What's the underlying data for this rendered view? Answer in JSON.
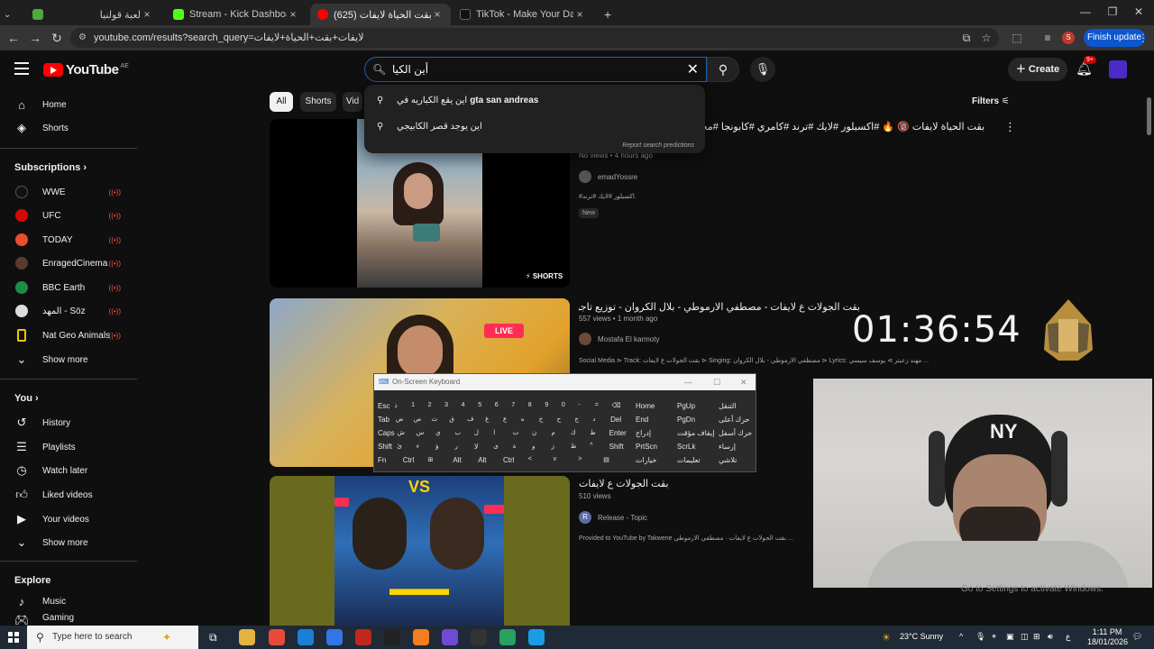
{
  "browser": {
    "tabs": [
      {
        "title": "لعبة قولنيا",
        "color": "#53a83d"
      },
      {
        "title": "Stream - Kick Dashboard",
        "color": "#53fc18"
      },
      {
        "title": "(625) لايفات بقت الحياة لايفات - ",
        "color": "#ff0000"
      },
      {
        "title": "TikTok - Make Your Day",
        "color": "#111111"
      }
    ],
    "new_tab": "+",
    "url": "youtube.com/results?search_query=لايفات+بقت+الحياة+لايفات",
    "profile_initial": "S",
    "finish_update": "Finish update"
  },
  "youtube": {
    "logo": "YouTube",
    "country": "AE",
    "search_value": "أين الكيا",
    "create": "Create",
    "notif_count": "9+",
    "suggestions": [
      {
        "prefix": "اين يقع الكباريه في ",
        "bold": "gta san andreas"
      },
      {
        "prefix": "اين يوجد قصر الكابيجي",
        "bold": ""
      }
    ],
    "report_predictions": "Report search predictions",
    "chips": [
      "All",
      "Shorts",
      "Vid"
    ],
    "filters": "Filters"
  },
  "sidebar": {
    "main": [
      {
        "label": "Home",
        "icon": "home-icon"
      },
      {
        "label": "Shorts",
        "icon": "shorts-icon"
      }
    ],
    "subscriptions_title": "Subscriptions",
    "subscriptions": [
      {
        "label": "WWE",
        "color": "#111111"
      },
      {
        "label": "UFC",
        "color": "#d20a0a"
      },
      {
        "label": "TODAY",
        "color": "#e84f2a"
      },
      {
        "label": "EnragedCinema",
        "color": "#5a3a2a"
      },
      {
        "label": "BBC Earth",
        "color": "#1f8a4c"
      },
      {
        "label": "المهد - Söz",
        "color": "#dddddd"
      },
      {
        "label": "Nat Geo Animals",
        "color": "#f5c400"
      }
    ],
    "show_more_1": "Show more",
    "you_title": "You",
    "you": [
      {
        "label": "History",
        "icon": "history-icon"
      },
      {
        "label": "Playlists",
        "icon": "playlists-icon"
      },
      {
        "label": "Watch later",
        "icon": "watch-later-icon"
      },
      {
        "label": "Liked videos",
        "icon": "liked-videos-icon"
      },
      {
        "label": "Your videos",
        "icon": "your-videos-icon"
      }
    ],
    "show_more_2": "Show more",
    "explore_title": "Explore",
    "explore": [
      {
        "label": "Music",
        "icon": "music-icon"
      },
      {
        "label": "Gaming",
        "icon": "gaming-icon"
      }
    ]
  },
  "results": [
    {
      "title": "بقت الحياة لايفات 🔞 🔥 #اكسبلور #لايك #ترند #كامري #كابونجا #محركات",
      "meta": "No views • 4 hours ago",
      "channel": "emadYossre",
      "desc": "#اكسبلور #لايك #ترند.",
      "badge": "New",
      "overlay": "SHORTS"
    },
    {
      "title": "بقت الجولات ع لايفات - مصطفي الارموطي - بلال الكروان - توزيع تاجو - 2025",
      "meta": "557 views • 1 month ago",
      "channel": "Mostafa El karmoty",
      "desc": "Social Media ⊳ Track: بقت الجولات ع لايفات ⊳ Singing: مصطفي الارموطي - بلال الكروان ⊳ Lyrics: مهند زعيتر ⊳ يوسف سيسي ...",
      "overlay": "LIVE"
    },
    {
      "title": "بقت الجولات ع لايفات",
      "meta": "510 views",
      "channel": "Release - Topic",
      "channel_initial": "R",
      "desc": "Provided to YouTube by Takwene بقت الجولات ع لايفات · مصطفي الارموطي ..."
    }
  ],
  "osk": {
    "title": "On-Screen Keyboard",
    "rows": [
      [
        "Esc",
        "ذ",
        "1",
        "2",
        "3",
        "4",
        "5",
        "6",
        "7",
        "8",
        "9",
        "0",
        "-",
        "=",
        "⌫"
      ],
      [
        "Tab",
        "ض",
        "ص",
        "ث",
        "ق",
        "ف",
        "غ",
        "ع",
        "ه",
        "خ",
        "ح",
        "ج",
        "د",
        "Del"
      ],
      [
        "Caps",
        "ش",
        "س",
        "ي",
        "ب",
        "ل",
        "ا",
        "ت",
        "ن",
        "م",
        "ك",
        "ط",
        "Enter"
      ],
      [
        "Shift",
        "ئ",
        "ء",
        "ؤ",
        "ر",
        "لا",
        "ى",
        "ة",
        "و",
        "ز",
        "ظ",
        "^",
        "Shift"
      ],
      [
        "Fn",
        "Ctrl",
        "⊞",
        "Alt",
        "Alt",
        "Ctrl",
        "<",
        "v",
        ">",
        "▤"
      ]
    ],
    "right": [
      [
        "Home",
        "PgUp",
        "التنقل"
      ],
      [
        "End",
        "PgDn",
        "حرك أعلى"
      ],
      [
        "إدراج",
        "إيقاف مؤقت",
        "حرك أسفل"
      ],
      [
        "PrtScn",
        "ScrLk",
        "إرساء"
      ],
      [
        "خيارات",
        "تعليمات",
        "تلاشي"
      ]
    ]
  },
  "overlay": {
    "timer": "01:36:54",
    "activate": "Go to Settings to activate Windows."
  },
  "taskbar": {
    "search_placeholder": "Type here to search",
    "weather": "23°C Sunny",
    "lang": "ع",
    "time": "1:11 PM",
    "date": "18/01/2026",
    "apps": [
      "#e84a3a",
      "#1b7fd6",
      "#3276e6",
      "#c0271d",
      "#222222",
      "#f57c1f",
      "#6e4ad6",
      "#333333",
      "#2aa060",
      "#1b9be6"
    ]
  }
}
